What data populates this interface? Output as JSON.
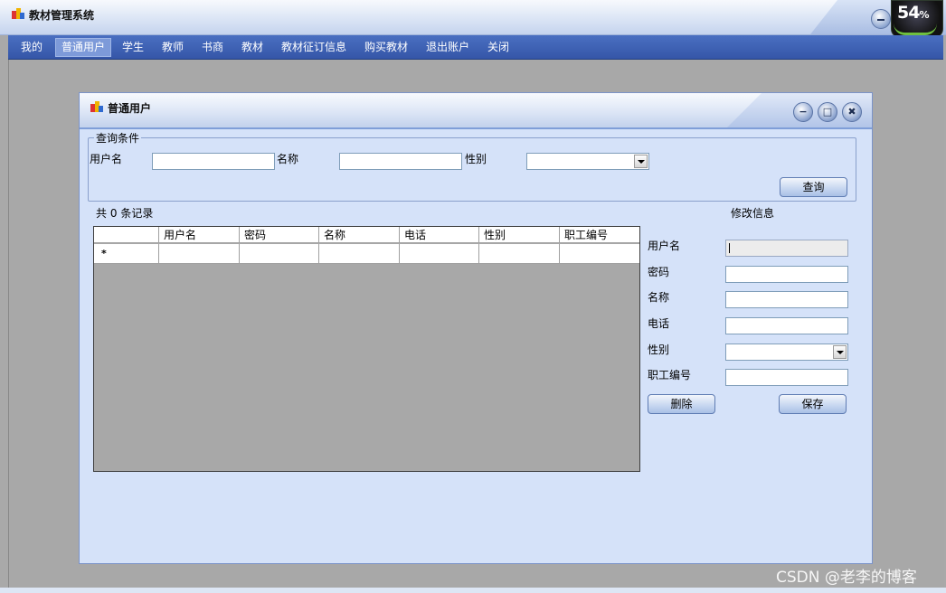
{
  "app": {
    "title": "教材管理系统"
  },
  "status": {
    "gauge_value": "54",
    "gauge_unit": "%"
  },
  "menu": [
    {
      "label": "我的"
    },
    {
      "label": "普通用户"
    },
    {
      "label": "学生"
    },
    {
      "label": "教师"
    },
    {
      "label": "书商"
    },
    {
      "label": "教材"
    },
    {
      "label": "教材征订信息"
    },
    {
      "label": "购买教材"
    },
    {
      "label": "退出账户"
    },
    {
      "label": "关闭"
    }
  ],
  "child": {
    "title": "普通用户",
    "controls": {
      "minimize": "−",
      "maximize": "□",
      "close": "✖"
    }
  },
  "query": {
    "legend": "查询条件",
    "username_label": "用户名",
    "username_value": "",
    "name_label": "名称",
    "name_value": "",
    "gender_label": "性别",
    "gender_value": "",
    "search_button": "查询"
  },
  "records": {
    "prefix": "共",
    "count": "0",
    "suffix": "条记录"
  },
  "grid": {
    "columns": [
      "用户名",
      "密码",
      "名称",
      "电话",
      "性别",
      "职工编号"
    ],
    "new_row_marker": "*",
    "rows": []
  },
  "edit": {
    "title": "修改信息",
    "username_label": "用户名",
    "username_value": "",
    "password_label": "密码",
    "password_value": "",
    "name_label": "名称",
    "name_value": "",
    "phone_label": "电话",
    "phone_value": "",
    "gender_label": "性别",
    "gender_value": "",
    "staff_id_label": "职工编号",
    "staff_id_value": "",
    "delete_button": "删除",
    "save_button": "保存"
  },
  "watermark": "CSDN @老李的博客"
}
